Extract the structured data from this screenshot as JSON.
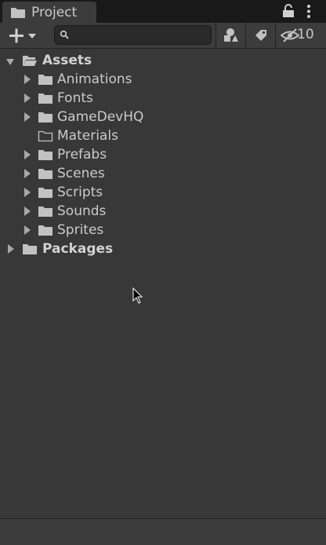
{
  "window": {
    "tab_label": "Project",
    "tab_icon": "folder-icon"
  },
  "toolbar": {
    "create_icon": "plus-icon",
    "search": {
      "value": "",
      "placeholder": ""
    },
    "filter_by_type_icon": "shapes-icon",
    "filter_by_label_icon": "tag-icon",
    "hidden_packages_icon": "eye-slash-icon",
    "hidden_packages_count": "10"
  },
  "tree": {
    "root": {
      "label": "Assets",
      "expanded": true
    },
    "children": [
      {
        "label": "Animations",
        "has_children": true
      },
      {
        "label": "Fonts",
        "has_children": true
      },
      {
        "label": "GameDevHQ",
        "has_children": true
      },
      {
        "label": "Materials",
        "has_children": false
      },
      {
        "label": "Prefabs",
        "has_children": true
      },
      {
        "label": "Scenes",
        "has_children": true
      },
      {
        "label": "Scripts",
        "has_children": true
      },
      {
        "label": "Sounds",
        "has_children": true
      },
      {
        "label": "Sprites",
        "has_children": true
      }
    ],
    "packages": {
      "label": "Packages",
      "expanded": false
    }
  },
  "colors": {
    "background": "#383838",
    "tab_strip": "#191919",
    "toolbar": "#3c3c3c",
    "text": "#c4c4c4",
    "icon": "#c2c2c2"
  }
}
